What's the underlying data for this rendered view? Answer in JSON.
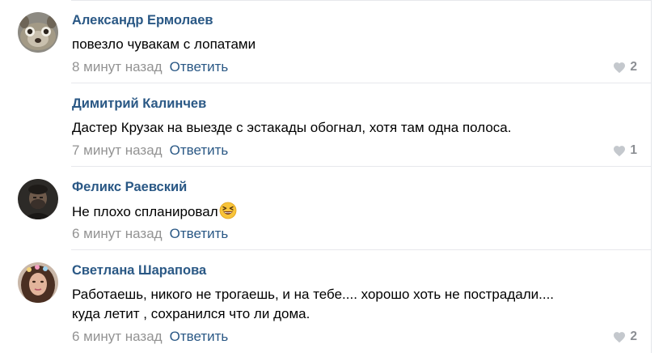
{
  "comments": [
    {
      "author": "Александр Ермолаев",
      "text": "повезло чувакам с лопатами",
      "time": "8 минут назад",
      "reply_label": "Ответить",
      "likes": "2",
      "avatar_icon": "dog-photo-avatar"
    },
    {
      "author": "Димитрий Калинчев",
      "text": "Дастер Крузак на выезде с эстакады обогнал, хотя там одна полоса.",
      "time": "7 минут назад",
      "reply_label": "Ответить",
      "likes": "1"
    },
    {
      "author": "Феликс Раевский",
      "text": "Не плохо спланировал",
      "emoji_icon": "laughing-emoji-icon",
      "time": "6 минут назад",
      "reply_label": "Ответить",
      "avatar_icon": "man-photo-avatar"
    },
    {
      "author": "Светлана Шарапова",
      "text_line1": "Работаешь, никого не трогаешь, и на тебе.... хорошо хоть не пострадали....",
      "text_line2": "куда летит , сохранился что ли дома.",
      "time": "6 минут назад",
      "reply_label": "Ответить",
      "likes": "2",
      "avatar_icon": "woman-photo-avatar"
    }
  ],
  "colors": {
    "link": "#2a5885",
    "meta": "#939393",
    "like": "#8c8f94",
    "divider": "#e7e8ec"
  }
}
